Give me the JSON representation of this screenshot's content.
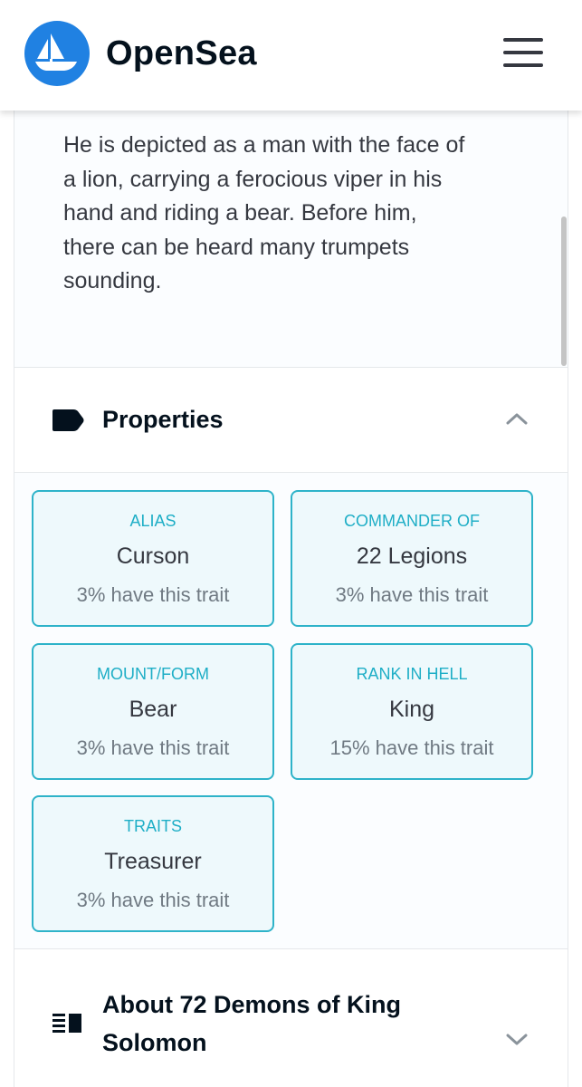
{
  "header": {
    "brand": "OpenSea",
    "logo_icon": "opensea-ship-icon",
    "menu_icon": "hamburger-menu-icon",
    "brand_color": "#2081e2"
  },
  "description": {
    "text": "He is depicted as a man with the face of\na lion, carrying a ferocious viper in his\nhand and riding a bear. Before him,\nthere can be heard many trumpets\nsounding."
  },
  "properties": {
    "title": "Properties",
    "icon": "tag-icon",
    "expanded_icon": "chevron-up-icon",
    "items": [
      {
        "type": "ALIAS",
        "value": "Curson",
        "rarity": "3% have this trait"
      },
      {
        "type": "COMMANDER OF",
        "value": "22 Legions",
        "rarity": "3% have this trait"
      },
      {
        "type": "MOUNT/FORM",
        "value": "Bear",
        "rarity": "3% have this trait"
      },
      {
        "type": "RANK IN HELL",
        "value": "King",
        "rarity": "15% have this trait"
      },
      {
        "type": "TRAITS",
        "value": "Treasurer",
        "rarity": "3% have this trait"
      }
    ]
  },
  "about": {
    "title": "About 72 Demons of King Solomon",
    "icon": "list-detail-icon",
    "collapsed_icon": "chevron-down-icon"
  },
  "colors": {
    "trait_border": "#2eb3c9",
    "trait_bg": "#eef9fc",
    "trait_type_text": "#1eaec6"
  }
}
